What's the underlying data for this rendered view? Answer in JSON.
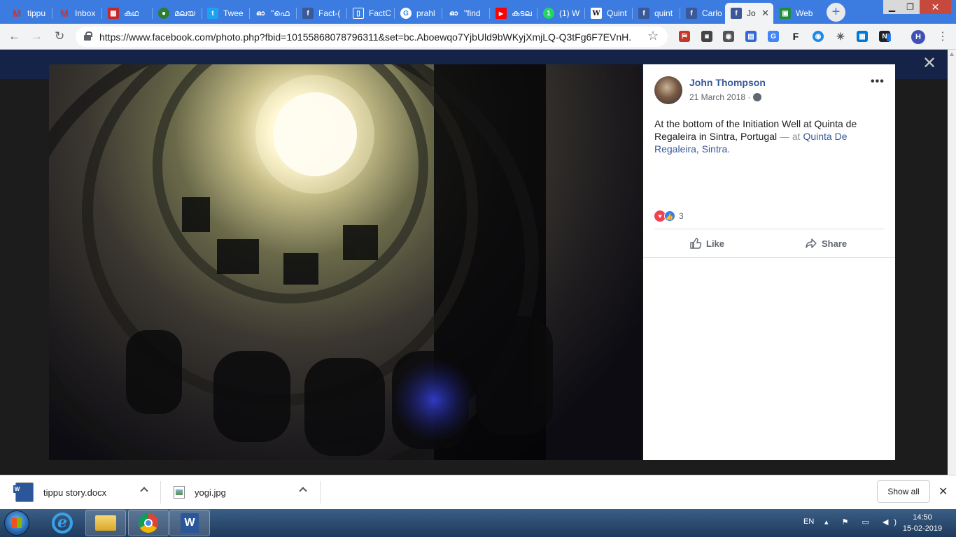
{
  "browser": {
    "tabs": [
      {
        "label": "tippu",
        "icon": "gmail-icon",
        "color": "#d93025",
        "glyph": "M"
      },
      {
        "label": "Inbox",
        "icon": "gmail-icon",
        "color": "#d93025",
        "glyph": "M"
      },
      {
        "label": "കഥ",
        "icon": "grid-icon",
        "color": "#c62828",
        "glyph": "▦"
      },
      {
        "label": "മലയ",
        "icon": "malayalam-site-icon",
        "color": "#2e7d32",
        "glyph": "●"
      },
      {
        "label": "Twee",
        "icon": "twitter-icon",
        "color": "#1da1f2",
        "glyph": "t"
      },
      {
        "label": "\"ഫെ",
        "icon": "tab-site-icon",
        "color": "#333333",
        "glyph": "ഓ"
      },
      {
        "label": "Fact-(",
        "icon": "facebook-icon",
        "color": "#3b5998",
        "glyph": "f"
      },
      {
        "label": "FactC",
        "icon": "document-icon",
        "color": "#777777",
        "glyph": "▯"
      },
      {
        "label": "prahl",
        "icon": "google-icon",
        "color": "#4285f4",
        "glyph": "G"
      },
      {
        "label": "\"find",
        "icon": "tab-site-icon",
        "color": "#333333",
        "glyph": "ഓ"
      },
      {
        "label": "കടല",
        "icon": "youtube-icon",
        "color": "#ff0000",
        "glyph": "▶"
      },
      {
        "label": "(1) W",
        "icon": "whatsapp-icon",
        "color": "#25d366",
        "glyph": "1"
      },
      {
        "label": "Quint",
        "icon": "wikipedia-icon",
        "color": "#ffffff",
        "glyph": "W"
      },
      {
        "label": "quint",
        "icon": "facebook-icon",
        "color": "#3b5998",
        "glyph": "f"
      },
      {
        "label": "Carlo",
        "icon": "facebook-icon",
        "color": "#3b5998",
        "glyph": "f"
      },
      {
        "label": "Jo",
        "icon": "facebook-icon",
        "color": "#3b5998",
        "glyph": "f",
        "active": true
      },
      {
        "label": "Web",
        "icon": "web-app-icon",
        "color": "#1e8e3e",
        "glyph": "▣"
      }
    ],
    "new_tab_label": "+",
    "url": "https://www.facebook.com/photo.php?fbid=10155868078796311&set=bc.Aboewqo7YjbUld9bWKyjXmjLQ-Q3tFg6F7EVnH...",
    "profile_initial": "H",
    "extensions": [
      {
        "name": "pdf-icon",
        "color": "#c1392b",
        "glyph": "⛿"
      },
      {
        "name": "invid-icon",
        "color": "#444444",
        "glyph": "▣"
      },
      {
        "name": "camera-icon",
        "color": "#555555",
        "glyph": "◉"
      },
      {
        "name": "image-search-icon",
        "color": "#3367d6",
        "glyph": "▤"
      },
      {
        "name": "translate-icon",
        "color": "#4285f4",
        "glyph": "G"
      },
      {
        "name": "f-icon",
        "color": "#111111",
        "glyph": "F"
      },
      {
        "name": "eye-icon",
        "color": "#1e88e5",
        "glyph": "◉"
      },
      {
        "name": "refresh-ext-icon",
        "color": "#555555",
        "glyph": "✳"
      },
      {
        "name": "windows-ext-icon",
        "color": "#0078d7",
        "glyph": "▦"
      },
      {
        "name": "n-icon",
        "color": "#202124",
        "glyph": "N"
      },
      {
        "name": "bookmark-ext-icon",
        "color": "#1a73e8",
        "glyph": "▮"
      }
    ]
  },
  "post": {
    "author": "John Thompson",
    "date": "21 March 2018 ·",
    "caption_text": "At the bottom of the Initiation Well at Quinta de Regaleira in Sintra, Portugal",
    "caption_at": " — at ",
    "location": "Quinta De Regaleira, Sintra",
    "location_end": ".",
    "reactions_count": "3",
    "like_label": "Like",
    "share_label": "Share",
    "more_label": "•••",
    "close_label": "✕"
  },
  "downloads": {
    "items": [
      {
        "name": "tippu story.docx",
        "icon": "word-doc-icon"
      },
      {
        "name": "yogi.jpg",
        "icon": "image-file-icon"
      }
    ],
    "show_all_label": "Show all",
    "close_label": "✕"
  },
  "taskbar": {
    "language": "EN",
    "tray_glyphs": "▴ ⚑ ▭ ◀)",
    "time": "14:50",
    "date": "15-02-2019",
    "apps": [
      "internet-explorer-icon",
      "file-explorer-icon",
      "chrome-icon",
      "word-icon"
    ]
  }
}
